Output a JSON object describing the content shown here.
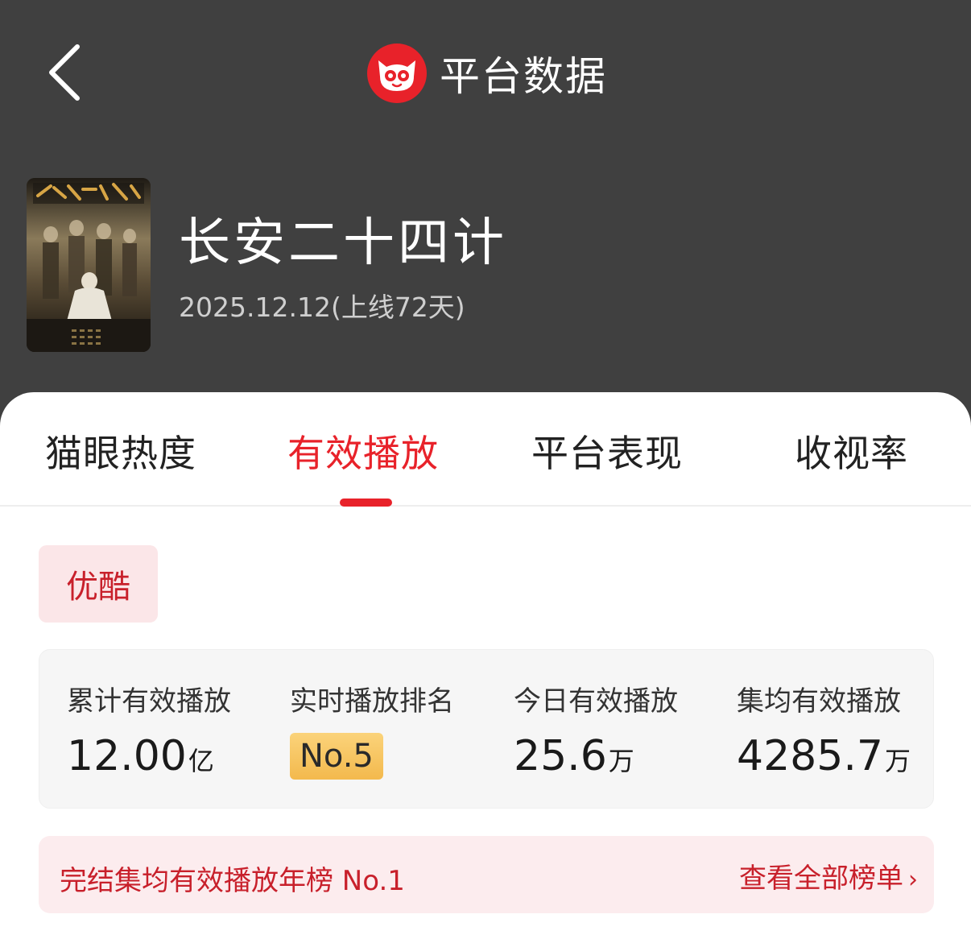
{
  "header": {
    "title": "平台数据"
  },
  "movie": {
    "title": "长安二十四计",
    "release_info": "2025.12.12(上线72天)"
  },
  "tabs": [
    {
      "label": "猫眼热度",
      "active": false
    },
    {
      "label": "有效播放",
      "active": true
    },
    {
      "label": "平台表现",
      "active": false
    },
    {
      "label": "收视率",
      "active": false
    }
  ],
  "platform": {
    "selected": "优酷"
  },
  "stats": {
    "total": {
      "label": "累计有效播放",
      "value": "12.00",
      "unit": "亿"
    },
    "rank": {
      "label": "实时播放排名",
      "value": "No.5"
    },
    "today": {
      "label": "今日有效播放",
      "value": "25.6",
      "unit": "万"
    },
    "per_episode": {
      "label": "集均有效播放",
      "value": "4285.7",
      "unit": "万"
    }
  },
  "banner": {
    "text": "完结集均有效播放年榜 No.1",
    "link_label": "查看全部榜单",
    "link_chevron": "›"
  },
  "colors": {
    "accent": "#e8222a",
    "header_bg": "#404040",
    "chip_bg": "#fbe6e8",
    "rank_badge": "#f3b94d"
  },
  "icons": {
    "back": "chevron-left-icon",
    "logo": "maoyan-cat-logo"
  }
}
